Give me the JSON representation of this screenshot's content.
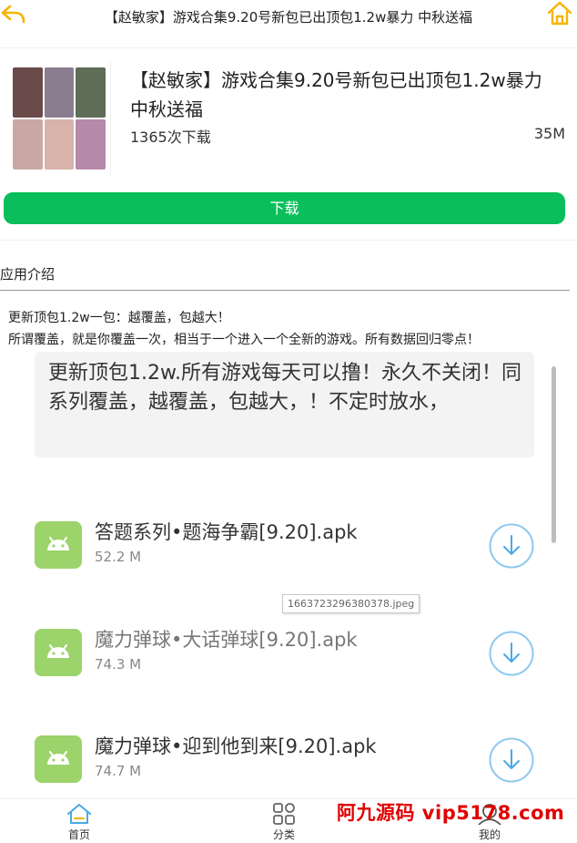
{
  "header": {
    "title": "【赵敏家】游戏合集9.20号新包已出顶包1.2w暴力 中秋送福",
    "back_icon": "back-arrow-icon",
    "home_icon": "home-icon"
  },
  "app": {
    "title": "【赵敏家】游戏合集9.20号新包已出顶包1.2w暴力 中秋送福",
    "downloads": "1365次下载",
    "size": "35M",
    "download_label": "下载"
  },
  "intro": {
    "heading": "应用介绍",
    "line1": "更新顶包1.2w一包：越覆盖，包越大！",
    "line2": "所谓覆盖，就是你覆盖一次，相当于一个进入一个全新的游戏。所有数据回归零点！"
  },
  "embed": {
    "note": "更新顶包1.2w.所有游戏每天可以撸！永久不关闭！同系列覆盖，越覆盖，包越大，！不定时放水，",
    "files": [
      {
        "name": "答题系列•题海争霸[9.20].apk",
        "size": "52.2 M"
      },
      {
        "name": "魔力弹球•大话弹球[9.20].apk",
        "size": "74.3 M"
      },
      {
        "name": "魔力弹球•迎到他到来[9.20].apk",
        "size": "74.7 M"
      }
    ],
    "tooltip": "1663723296380378.jpeg"
  },
  "nav": {
    "home": "首页",
    "category": "分类",
    "me": "我的"
  },
  "watermark": "阿九源码  vip5178.com",
  "colors": {
    "accent_yellow": "#f5b400",
    "download_green": "#0abf5b",
    "android_green": "#9cd36b",
    "download_circle_blue": "#4aa8e8",
    "watermark_red": "#e00000"
  }
}
